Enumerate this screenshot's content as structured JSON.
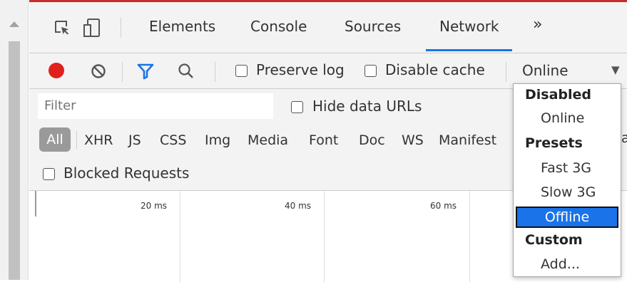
{
  "tabs": {
    "items": [
      {
        "label": "Elements",
        "active": false
      },
      {
        "label": "Console",
        "active": false
      },
      {
        "label": "Sources",
        "active": false
      },
      {
        "label": "Network",
        "active": true
      }
    ],
    "overflow_label": "»"
  },
  "toolbar": {
    "record_icon": "record-icon",
    "clear_icon": "clear-icon",
    "filter_icon": "filter-icon",
    "search_icon": "search-icon",
    "preserve_log_label": "Preserve log",
    "preserve_log_checked": false,
    "disable_cache_label": "Disable cache",
    "disable_cache_checked": false,
    "throttle_value": "Online",
    "record_color": "#e0201c",
    "accent_color": "#1a73e8"
  },
  "filters": {
    "filter_placeholder": "Filter",
    "hide_data_urls_label": "Hide data URLs",
    "hide_data_urls_checked": false,
    "types": [
      "All",
      "XHR",
      "JS",
      "CSS",
      "Img",
      "Media",
      "Font",
      "Doc",
      "WS",
      "Manifest"
    ],
    "active_type": "All",
    "blocked_requests_label": "Blocked Requests",
    "blocked_requests_checked": false
  },
  "timeline": {
    "ticks": [
      "20 ms",
      "40 ms",
      "60 ms"
    ]
  },
  "throttle_menu": {
    "group_disabled": "Disabled",
    "item_online": "Online",
    "group_presets": "Presets",
    "item_fast3g": "Fast 3G",
    "item_slow3g": "Slow 3G",
    "item_offline": "Offline",
    "selected": "Offline",
    "group_custom": "Custom",
    "item_add": "Add..."
  }
}
